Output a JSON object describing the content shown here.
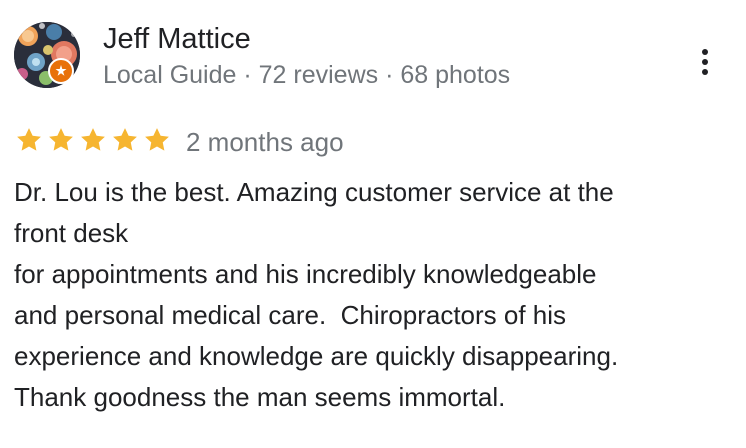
{
  "review": {
    "author": {
      "name": "Jeff Mattice",
      "meta": "Local Guide · 72 reviews · 68 photos",
      "avatar_icon": "profile-photo",
      "badge_icon": "local-guide-badge-icon"
    },
    "rating": 5,
    "rating_max": 5,
    "star_color": "#f6b530",
    "date": "2 months ago",
    "text_lines": [
      "Dr. Lou is the best. Amazing customer service at the",
      "front desk",
      "for appointments and his incredibly knowledgeable",
      "and personal medical care.  Chiropractors of his",
      "experience and knowledge are quickly disappearing.",
      "Thank goodness the man seems immortal."
    ],
    "more_icon": "more-vertical-icon"
  }
}
